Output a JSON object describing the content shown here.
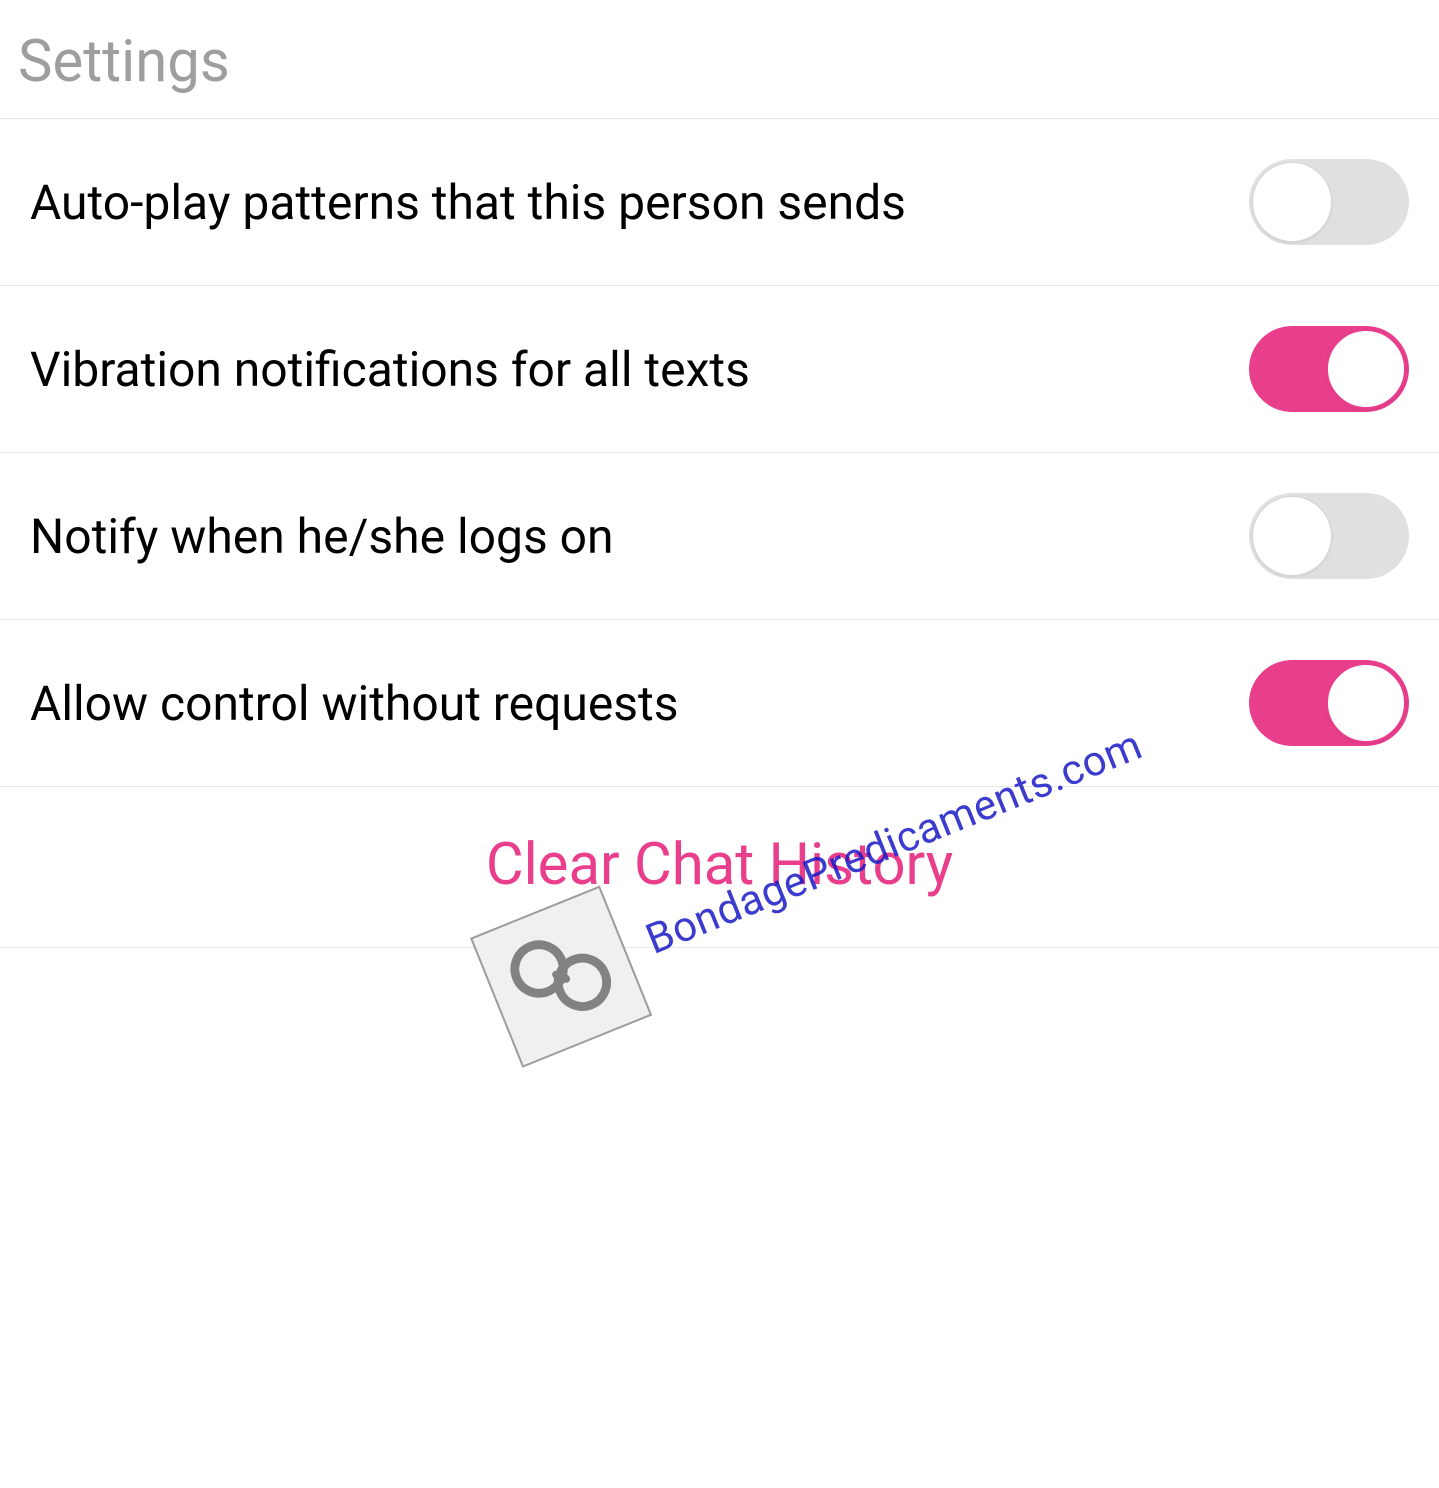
{
  "page_title": "Settings",
  "accent_color": "#e83e8c",
  "settings": [
    {
      "key": "auto_play",
      "label": "Auto-play patterns that this person sends",
      "on": false
    },
    {
      "key": "vibration_notify",
      "label": "Vibration notifications for all texts",
      "on": true
    },
    {
      "key": "notify_logon",
      "label": "Notify when he/she logs on",
      "on": false
    },
    {
      "key": "allow_control",
      "label": "Allow control without requests",
      "on": true
    }
  ],
  "clear_chat_label": "Clear Chat History",
  "watermark": {
    "text": "BondagePredicaments.com",
    "icon": "handcuffs-icon"
  }
}
